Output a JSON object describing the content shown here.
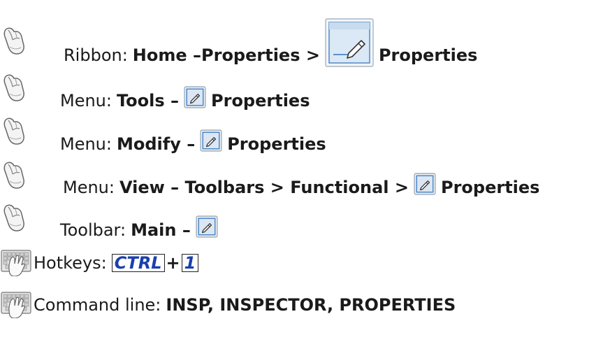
{
  "rows": [
    {
      "label": "Ribbon:",
      "path": "Home –Properties >",
      "target": "Properties",
      "icon": "pencil-properties-icon-large"
    },
    {
      "label": "Menu:",
      "path": "Tools –",
      "target": "Properties",
      "icon": "pencil-properties-icon"
    },
    {
      "label": "Menu:",
      "path": "Modify –",
      "target": "Properties",
      "icon": "pencil-properties-icon"
    },
    {
      "label": "Menu:",
      "path": "View – Toolbars > Functional >",
      "target": "Properties",
      "icon": "pencil-properties-icon"
    },
    {
      "label": "Toolbar:",
      "path": "Main –",
      "icon": "pencil-properties-icon"
    }
  ],
  "hotkeys": {
    "label": "Hotkeys:",
    "key1": "CTRL",
    "plus": "+",
    "key2": "1"
  },
  "command_line": {
    "label": "Command line:",
    "value": "INSP, INSPECTOR, PROPERTIES"
  },
  "icons": {
    "mouse": "mouse-hand-icon",
    "keyboard": "keyboard-hand-icon"
  },
  "colors": {
    "hotkey_text": "#1a3fae",
    "icon_frame": "#4a86c8"
  }
}
